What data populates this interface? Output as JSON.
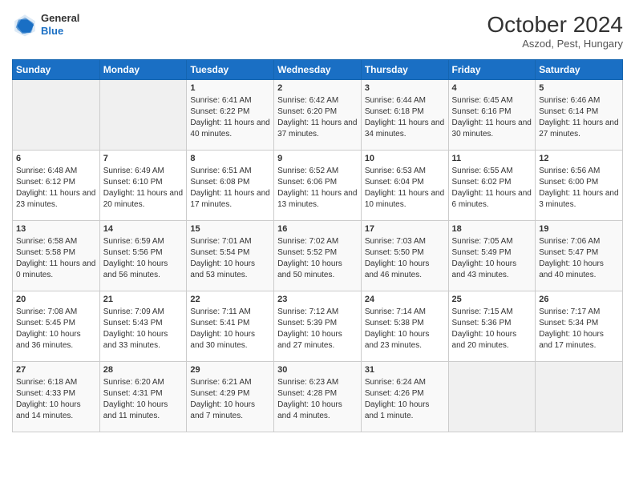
{
  "header": {
    "logo_general": "General",
    "logo_blue": "Blue",
    "title": "October 2024",
    "subtitle": "Aszod, Pest, Hungary"
  },
  "weekdays": [
    "Sunday",
    "Monday",
    "Tuesday",
    "Wednesday",
    "Thursday",
    "Friday",
    "Saturday"
  ],
  "weeks": [
    [
      {
        "day": "",
        "empty": true
      },
      {
        "day": "",
        "empty": true
      },
      {
        "day": "1",
        "sunrise": "Sunrise: 6:41 AM",
        "sunset": "Sunset: 6:22 PM",
        "daylight": "Daylight: 11 hours and 40 minutes."
      },
      {
        "day": "2",
        "sunrise": "Sunrise: 6:42 AM",
        "sunset": "Sunset: 6:20 PM",
        "daylight": "Daylight: 11 hours and 37 minutes."
      },
      {
        "day": "3",
        "sunrise": "Sunrise: 6:44 AM",
        "sunset": "Sunset: 6:18 PM",
        "daylight": "Daylight: 11 hours and 34 minutes."
      },
      {
        "day": "4",
        "sunrise": "Sunrise: 6:45 AM",
        "sunset": "Sunset: 6:16 PM",
        "daylight": "Daylight: 11 hours and 30 minutes."
      },
      {
        "day": "5",
        "sunrise": "Sunrise: 6:46 AM",
        "sunset": "Sunset: 6:14 PM",
        "daylight": "Daylight: 11 hours and 27 minutes."
      }
    ],
    [
      {
        "day": "6",
        "sunrise": "Sunrise: 6:48 AM",
        "sunset": "Sunset: 6:12 PM",
        "daylight": "Daylight: 11 hours and 23 minutes."
      },
      {
        "day": "7",
        "sunrise": "Sunrise: 6:49 AM",
        "sunset": "Sunset: 6:10 PM",
        "daylight": "Daylight: 11 hours and 20 minutes."
      },
      {
        "day": "8",
        "sunrise": "Sunrise: 6:51 AM",
        "sunset": "Sunset: 6:08 PM",
        "daylight": "Daylight: 11 hours and 17 minutes."
      },
      {
        "day": "9",
        "sunrise": "Sunrise: 6:52 AM",
        "sunset": "Sunset: 6:06 PM",
        "daylight": "Daylight: 11 hours and 13 minutes."
      },
      {
        "day": "10",
        "sunrise": "Sunrise: 6:53 AM",
        "sunset": "Sunset: 6:04 PM",
        "daylight": "Daylight: 11 hours and 10 minutes."
      },
      {
        "day": "11",
        "sunrise": "Sunrise: 6:55 AM",
        "sunset": "Sunset: 6:02 PM",
        "daylight": "Daylight: 11 hours and 6 minutes."
      },
      {
        "day": "12",
        "sunrise": "Sunrise: 6:56 AM",
        "sunset": "Sunset: 6:00 PM",
        "daylight": "Daylight: 11 hours and 3 minutes."
      }
    ],
    [
      {
        "day": "13",
        "sunrise": "Sunrise: 6:58 AM",
        "sunset": "Sunset: 5:58 PM",
        "daylight": "Daylight: 11 hours and 0 minutes."
      },
      {
        "day": "14",
        "sunrise": "Sunrise: 6:59 AM",
        "sunset": "Sunset: 5:56 PM",
        "daylight": "Daylight: 10 hours and 56 minutes."
      },
      {
        "day": "15",
        "sunrise": "Sunrise: 7:01 AM",
        "sunset": "Sunset: 5:54 PM",
        "daylight": "Daylight: 10 hours and 53 minutes."
      },
      {
        "day": "16",
        "sunrise": "Sunrise: 7:02 AM",
        "sunset": "Sunset: 5:52 PM",
        "daylight": "Daylight: 10 hours and 50 minutes."
      },
      {
        "day": "17",
        "sunrise": "Sunrise: 7:03 AM",
        "sunset": "Sunset: 5:50 PM",
        "daylight": "Daylight: 10 hours and 46 minutes."
      },
      {
        "day": "18",
        "sunrise": "Sunrise: 7:05 AM",
        "sunset": "Sunset: 5:49 PM",
        "daylight": "Daylight: 10 hours and 43 minutes."
      },
      {
        "day": "19",
        "sunrise": "Sunrise: 7:06 AM",
        "sunset": "Sunset: 5:47 PM",
        "daylight": "Daylight: 10 hours and 40 minutes."
      }
    ],
    [
      {
        "day": "20",
        "sunrise": "Sunrise: 7:08 AM",
        "sunset": "Sunset: 5:45 PM",
        "daylight": "Daylight: 10 hours and 36 minutes."
      },
      {
        "day": "21",
        "sunrise": "Sunrise: 7:09 AM",
        "sunset": "Sunset: 5:43 PM",
        "daylight": "Daylight: 10 hours and 33 minutes."
      },
      {
        "day": "22",
        "sunrise": "Sunrise: 7:11 AM",
        "sunset": "Sunset: 5:41 PM",
        "daylight": "Daylight: 10 hours and 30 minutes."
      },
      {
        "day": "23",
        "sunrise": "Sunrise: 7:12 AM",
        "sunset": "Sunset: 5:39 PM",
        "daylight": "Daylight: 10 hours and 27 minutes."
      },
      {
        "day": "24",
        "sunrise": "Sunrise: 7:14 AM",
        "sunset": "Sunset: 5:38 PM",
        "daylight": "Daylight: 10 hours and 23 minutes."
      },
      {
        "day": "25",
        "sunrise": "Sunrise: 7:15 AM",
        "sunset": "Sunset: 5:36 PM",
        "daylight": "Daylight: 10 hours and 20 minutes."
      },
      {
        "day": "26",
        "sunrise": "Sunrise: 7:17 AM",
        "sunset": "Sunset: 5:34 PM",
        "daylight": "Daylight: 10 hours and 17 minutes."
      }
    ],
    [
      {
        "day": "27",
        "sunrise": "Sunrise: 6:18 AM",
        "sunset": "Sunset: 4:33 PM",
        "daylight": "Daylight: 10 hours and 14 minutes."
      },
      {
        "day": "28",
        "sunrise": "Sunrise: 6:20 AM",
        "sunset": "Sunset: 4:31 PM",
        "daylight": "Daylight: 10 hours and 11 minutes."
      },
      {
        "day": "29",
        "sunrise": "Sunrise: 6:21 AM",
        "sunset": "Sunset: 4:29 PM",
        "daylight": "Daylight: 10 hours and 7 minutes."
      },
      {
        "day": "30",
        "sunrise": "Sunrise: 6:23 AM",
        "sunset": "Sunset: 4:28 PM",
        "daylight": "Daylight: 10 hours and 4 minutes."
      },
      {
        "day": "31",
        "sunrise": "Sunrise: 6:24 AM",
        "sunset": "Sunset: 4:26 PM",
        "daylight": "Daylight: 10 hours and 1 minute."
      },
      {
        "day": "",
        "empty": true
      },
      {
        "day": "",
        "empty": true
      }
    ]
  ]
}
